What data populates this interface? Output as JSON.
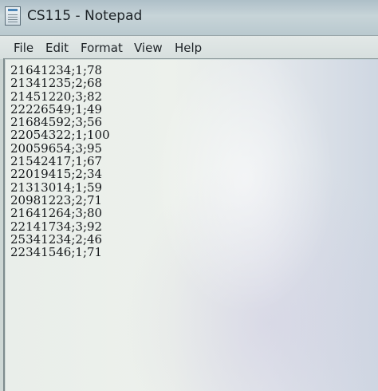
{
  "window": {
    "title": "CS115 - Notepad",
    "icon": "notepad-icon"
  },
  "menu": {
    "items": [
      "File",
      "Edit",
      "Format",
      "View",
      "Help"
    ]
  },
  "editor": {
    "lines": [
      "21641234;1;78",
      "21341235;2;68",
      "21451220;3;82",
      "22226549;1;49",
      "21684592;3;56",
      "22054322;1;100",
      "20059654;3;95",
      "21542417;1;67",
      "22019415;2;34",
      "21313014;1;59",
      "20981223;2;71",
      "21641264;3;80",
      "22141734;3;92",
      "25341234;2;46",
      "22341546;1;71"
    ]
  }
}
